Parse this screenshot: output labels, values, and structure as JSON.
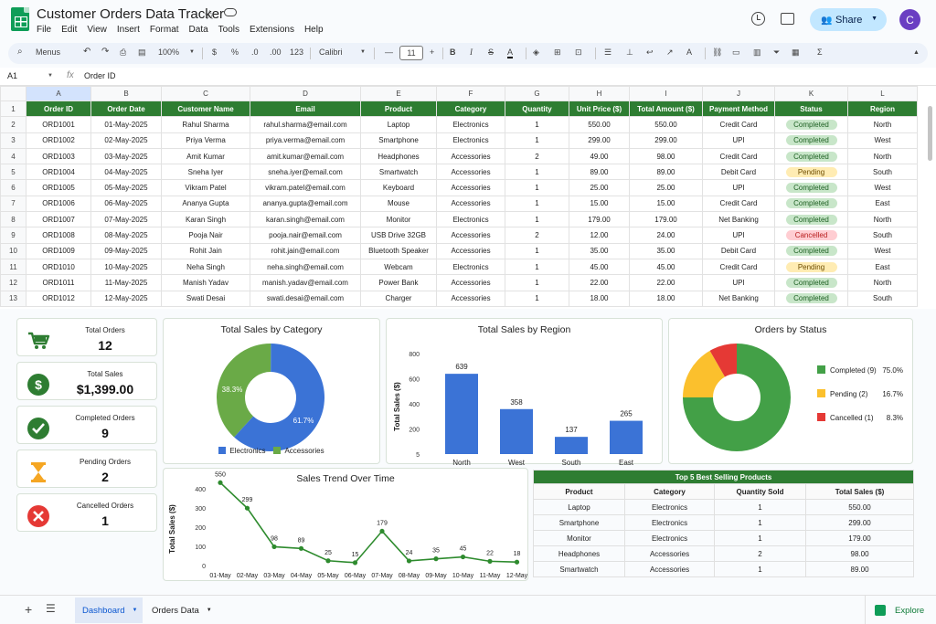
{
  "app": {
    "title": "Customer Orders Data Tracker",
    "menus": [
      "File",
      "Edit",
      "View",
      "Insert",
      "Format",
      "Data",
      "Tools",
      "Extensions",
      "Help"
    ],
    "share_label": "Share",
    "avatar_letter": "C"
  },
  "toolbar": {
    "search_menus": "Menus",
    "zoom": "100%",
    "currency": "$",
    "percent": "%",
    "dec_less": ".0",
    "dec_more": ".00",
    "number_format": "123",
    "font": "Calibri",
    "font_size": "11"
  },
  "formula_bar": {
    "cell_ref": "A1",
    "fx": "fx",
    "value": "Order ID"
  },
  "sheet": {
    "columns": [
      "A",
      "B",
      "C",
      "D",
      "E",
      "F",
      "G",
      "H",
      "I",
      "J",
      "K",
      "L"
    ],
    "headers": [
      "Order ID",
      "Order Date",
      "Customer Name",
      "Email",
      "Product",
      "Category",
      "Quantity",
      "Unit Price ($)",
      "Total Amount ($)",
      "Payment Method",
      "Status",
      "Region"
    ],
    "rows": [
      [
        "ORD1001",
        "01-May-2025",
        "Rahul Sharma",
        "rahul.sharma@email.com",
        "Laptop",
        "Electronics",
        "1",
        "550.00",
        "550.00",
        "Credit Card",
        "Completed",
        "North"
      ],
      [
        "ORD1002",
        "02-May-2025",
        "Priya Verma",
        "priya.verma@email.com",
        "Smartphone",
        "Electronics",
        "1",
        "299.00",
        "299.00",
        "UPI",
        "Completed",
        "West"
      ],
      [
        "ORD1003",
        "03-May-2025",
        "Amit Kumar",
        "amit.kumar@email.com",
        "Headphones",
        "Accessories",
        "2",
        "49.00",
        "98.00",
        "Credit Card",
        "Completed",
        "North"
      ],
      [
        "ORD1004",
        "04-May-2025",
        "Sneha Iyer",
        "sneha.iyer@email.com",
        "Smartwatch",
        "Accessories",
        "1",
        "89.00",
        "89.00",
        "Debit Card",
        "Pending",
        "South"
      ],
      [
        "ORD1005",
        "05-May-2025",
        "Vikram Patel",
        "vikram.patel@email.com",
        "Keyboard",
        "Accessories",
        "1",
        "25.00",
        "25.00",
        "UPI",
        "Completed",
        "West"
      ],
      [
        "ORD1006",
        "06-May-2025",
        "Ananya Gupta",
        "ananya.gupta@email.com",
        "Mouse",
        "Accessories",
        "1",
        "15.00",
        "15.00",
        "Credit Card",
        "Completed",
        "East"
      ],
      [
        "ORD1007",
        "07-May-2025",
        "Karan Singh",
        "karan.singh@email.com",
        "Monitor",
        "Electronics",
        "1",
        "179.00",
        "179.00",
        "Net Banking",
        "Completed",
        "North"
      ],
      [
        "ORD1008",
        "08-May-2025",
        "Pooja Nair",
        "pooja.nair@email.com",
        "USB Drive 32GB",
        "Accessories",
        "2",
        "12.00",
        "24.00",
        "UPI",
        "Cancelled",
        "South"
      ],
      [
        "ORD1009",
        "09-May-2025",
        "Rohit Jain",
        "rohit.jain@email.com",
        "Bluetooth Speaker",
        "Accessories",
        "1",
        "35.00",
        "35.00",
        "Debit Card",
        "Completed",
        "West"
      ],
      [
        "ORD1010",
        "10-May-2025",
        "Neha Singh",
        "neha.singh@email.com",
        "Webcam",
        "Electronics",
        "1",
        "45.00",
        "45.00",
        "Credit Card",
        "Pending",
        "East"
      ],
      [
        "ORD1011",
        "11-May-2025",
        "Manish Yadav",
        "manish.yadav@email.com",
        "Power Bank",
        "Accessories",
        "1",
        "22.00",
        "22.00",
        "UPI",
        "Completed",
        "North"
      ],
      [
        "ORD1012",
        "12-May-2025",
        "Swati Desai",
        "swati.desai@email.com",
        "Charger",
        "Accessories",
        "1",
        "18.00",
        "18.00",
        "Net Banking",
        "Completed",
        "South"
      ]
    ],
    "status_colors": {
      "Completed": [
        "#c8e6c9",
        "#1b5e20"
      ],
      "Pending": [
        "#ffecb3",
        "#6d4c00"
      ],
      "Cancelled": [
        "#ffcdd2",
        "#b71c1c"
      ]
    }
  },
  "kpis": [
    {
      "label": "Total Orders",
      "value": "12",
      "icon": "cart-icon",
      "color": "#2e7d32"
    },
    {
      "label": "Total Sales",
      "value": "$1,399.00",
      "icon": "dollar-icon",
      "color": "#2e7d32"
    },
    {
      "label": "Completed Orders",
      "value": "9",
      "icon": "check-icon",
      "color": "#2e7d32"
    },
    {
      "label": "Pending Orders",
      "value": "2",
      "icon": "hourglass-icon",
      "color": "#f5a623"
    },
    {
      "label": "Cancelled Orders",
      "value": "1",
      "icon": "x-icon",
      "color": "#e53935"
    }
  ],
  "chart_data": [
    {
      "type": "pie",
      "title": "Total Sales by Category",
      "categories": [
        "Electronics",
        "Accessories"
      ],
      "values": [
        61.7,
        38.3
      ],
      "labels": [
        "61.7%",
        "38.3%"
      ],
      "colors": [
        "#3b73d6",
        "#6aaa47"
      ],
      "legend": "bottom"
    },
    {
      "type": "bar",
      "title": "Total Sales by Region",
      "categories": [
        "North",
        "West",
        "South",
        "East"
      ],
      "values": [
        639,
        358,
        137,
        265
      ],
      "ylabel": "Total Sales ($)",
      "ylim": [
        0,
        800
      ],
      "yticks": [
        0,
        200,
        400,
        600,
        800
      ],
      "ytick_labels": [
        "5",
        "200",
        "400",
        "600",
        "800"
      ],
      "color": "#3b73d6"
    },
    {
      "type": "pie",
      "title": "Orders by Status",
      "categories": [
        "Completed (9)",
        "Pending (2)",
        "Cancelled (1)"
      ],
      "values": [
        75.0,
        16.7,
        8.3
      ],
      "percent_labels": [
        "75.0%",
        "16.7%",
        "8.3%"
      ],
      "colors": [
        "#43a047",
        "#fbc02d",
        "#e53935"
      ],
      "legend": "right"
    },
    {
      "type": "line",
      "title": "Sales Trend Over Time",
      "x": [
        "01-May",
        "02-May",
        "03-May",
        "04-May",
        "05-May",
        "06-May",
        "07-May",
        "08-May",
        "09-May",
        "10-May",
        "11-May",
        "12-May"
      ],
      "y": [
        550,
        299,
        98,
        89,
        25,
        15,
        179,
        24,
        35,
        45,
        22,
        18
      ],
      "ylabel": "Total Sales ($)",
      "ylim": [
        0,
        400
      ],
      "yticks": [
        0,
        100,
        200,
        300,
        400
      ],
      "color": "#2e8b2e",
      "note": "first point drawn clipped at top of plot"
    }
  ],
  "top5": {
    "title": "Top 5 Best Selling Products",
    "headers": [
      "Product",
      "Category",
      "Quantity Sold",
      "Total Sales ($)"
    ],
    "rows": [
      [
        "Laptop",
        "Electronics",
        "1",
        "550.00"
      ],
      [
        "Smartphone",
        "Electronics",
        "1",
        "299.00"
      ],
      [
        "Monitor",
        "Electronics",
        "1",
        "179.00"
      ],
      [
        "Headphones",
        "Accessories",
        "2",
        "98.00"
      ],
      [
        "Smartwatch",
        "Accessories",
        "1",
        "89.00"
      ]
    ]
  },
  "tabs": {
    "add": "+",
    "active": "Dashboard",
    "other": "Orders Data",
    "explore": "Explore"
  }
}
